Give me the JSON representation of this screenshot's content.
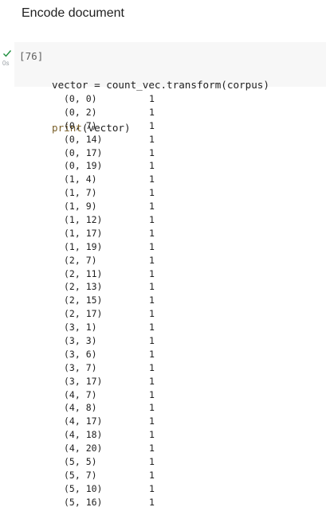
{
  "heading": "Encode document",
  "cell": {
    "exec_count": "[76]",
    "run_time": "0s",
    "code": {
      "line1": "vector = count_vec.transform(corpus)",
      "line2_fn": "print",
      "line2_rest": "(vector)"
    }
  },
  "output": {
    "rows": [
      {
        "idx": "(0, 0)",
        "val": "1"
      },
      {
        "idx": "(0, 2)",
        "val": "1"
      },
      {
        "idx": "(0, 7)",
        "val": "1"
      },
      {
        "idx": "(0, 14)",
        "val": "1"
      },
      {
        "idx": "(0, 17)",
        "val": "1"
      },
      {
        "idx": "(0, 19)",
        "val": "1"
      },
      {
        "idx": "(1, 4)",
        "val": "1"
      },
      {
        "idx": "(1, 7)",
        "val": "1"
      },
      {
        "idx": "(1, 9)",
        "val": "1"
      },
      {
        "idx": "(1, 12)",
        "val": "1"
      },
      {
        "idx": "(1, 17)",
        "val": "1"
      },
      {
        "idx": "(1, 19)",
        "val": "1"
      },
      {
        "idx": "(2, 7)",
        "val": "1"
      },
      {
        "idx": "(2, 11)",
        "val": "1"
      },
      {
        "idx": "(2, 13)",
        "val": "1"
      },
      {
        "idx": "(2, 15)",
        "val": "1"
      },
      {
        "idx": "(2, 17)",
        "val": "1"
      },
      {
        "idx": "(3, 1)",
        "val": "1"
      },
      {
        "idx": "(3, 3)",
        "val": "1"
      },
      {
        "idx": "(3, 6)",
        "val": "1"
      },
      {
        "idx": "(3, 7)",
        "val": "1"
      },
      {
        "idx": "(3, 17)",
        "val": "1"
      },
      {
        "idx": "(4, 7)",
        "val": "1"
      },
      {
        "idx": "(4, 8)",
        "val": "1"
      },
      {
        "idx": "(4, 17)",
        "val": "1"
      },
      {
        "idx": "(4, 18)",
        "val": "1"
      },
      {
        "idx": "(4, 20)",
        "val": "1"
      },
      {
        "idx": "(5, 5)",
        "val": "1"
      },
      {
        "idx": "(5, 7)",
        "val": "1"
      },
      {
        "idx": "(5, 10)",
        "val": "1"
      },
      {
        "idx": "(5, 16)",
        "val": "1"
      }
    ]
  },
  "colors": {
    "check": "#1e8e3e",
    "code_bg": "#f7f7f7"
  }
}
